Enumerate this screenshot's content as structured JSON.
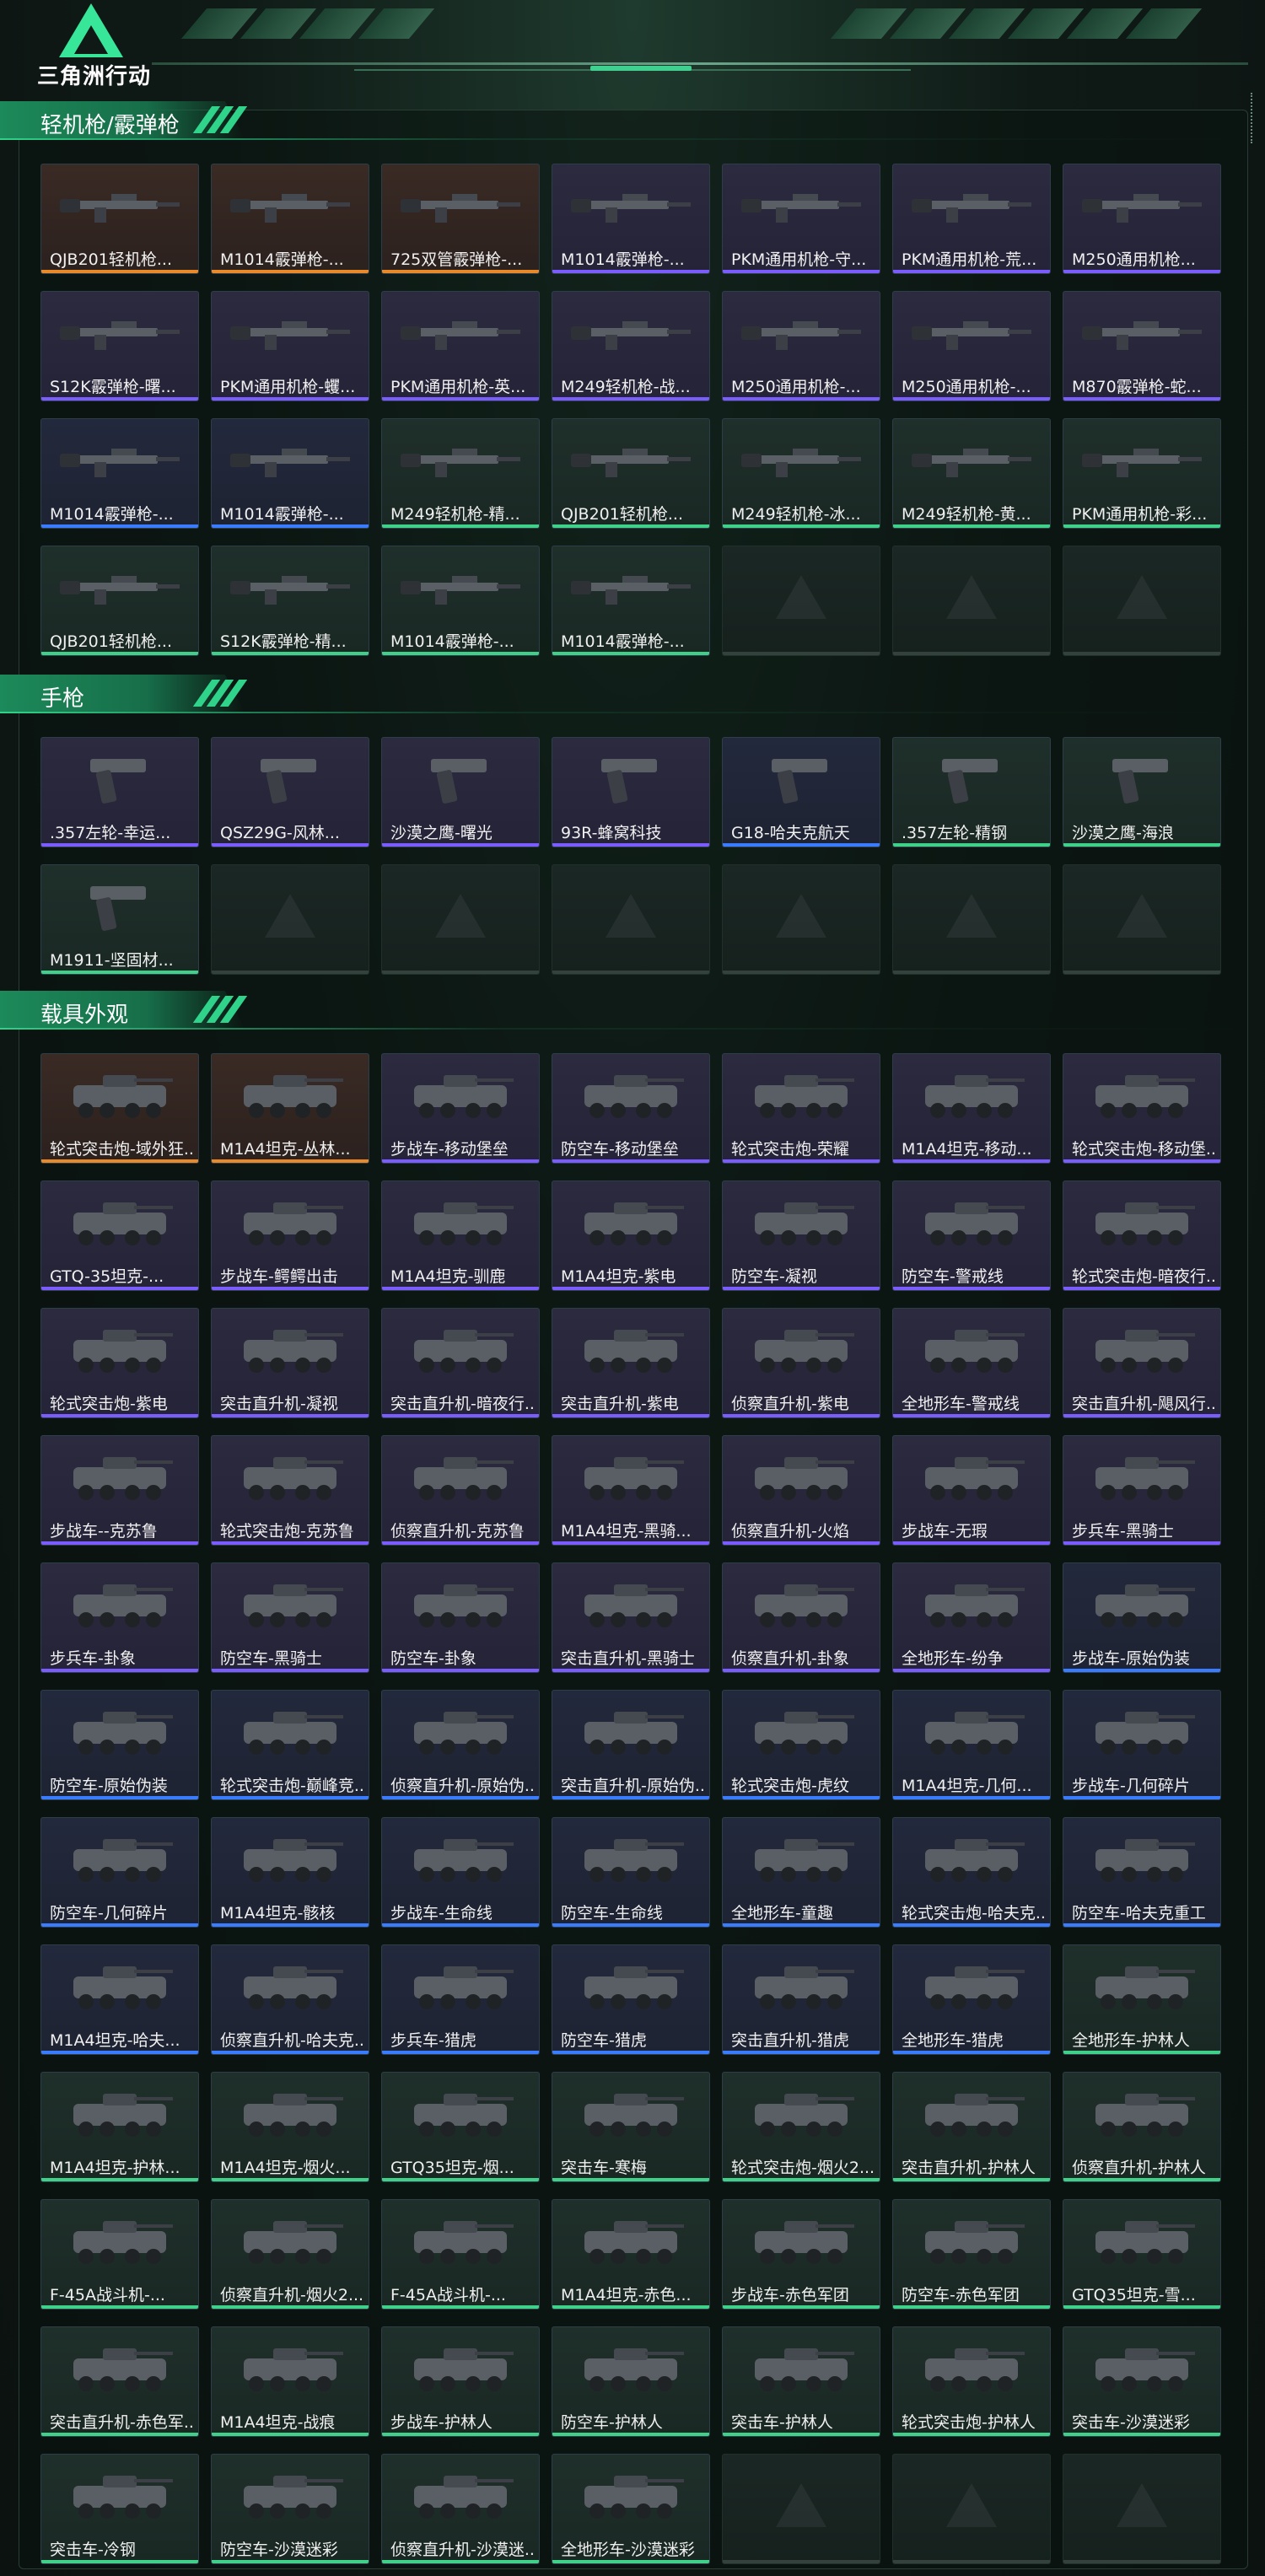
{
  "app": {
    "logo_text": "三角洲行动"
  },
  "sections": [
    {
      "title": "轻机枪/霰弹枪",
      "kind": "gun",
      "items": [
        {
          "label": "QJB201轻机枪...",
          "rarity": "orange"
        },
        {
          "label": "M1014霰弹枪-...",
          "rarity": "orange"
        },
        {
          "label": "725双管霰弹枪-...",
          "rarity": "orange"
        },
        {
          "label": "M1014霰弹枪-...",
          "rarity": "purple"
        },
        {
          "label": "PKM通用机枪-守...",
          "rarity": "purple"
        },
        {
          "label": "PKM通用机枪-荒...",
          "rarity": "purple"
        },
        {
          "label": "M250通用机枪...",
          "rarity": "purple"
        },
        {
          "label": "S12K霰弹枪-曙...",
          "rarity": "purple"
        },
        {
          "label": "PKM通用机枪-蠼...",
          "rarity": "purple"
        },
        {
          "label": "PKM通用机枪-英...",
          "rarity": "purple"
        },
        {
          "label": "M249轻机枪-战...",
          "rarity": "purple"
        },
        {
          "label": "M250通用机枪-...",
          "rarity": "purple"
        },
        {
          "label": "M250通用机枪-...",
          "rarity": "purple"
        },
        {
          "label": "M870霰弹枪-蛇...",
          "rarity": "purple"
        },
        {
          "label": "M1014霰弹枪-...",
          "rarity": "blue"
        },
        {
          "label": "M1014霰弹枪-...",
          "rarity": "blue"
        },
        {
          "label": "M249轻机枪-精...",
          "rarity": "green"
        },
        {
          "label": "QJB201轻机枪...",
          "rarity": "green"
        },
        {
          "label": "M249轻机枪-冰...",
          "rarity": "green"
        },
        {
          "label": "M249轻机枪-黄...",
          "rarity": "green"
        },
        {
          "label": "PKM通用机枪-彩...",
          "rarity": "green"
        },
        {
          "label": "QJB201轻机枪...",
          "rarity": "green"
        },
        {
          "label": "S12K霰弹枪-精...",
          "rarity": "green"
        },
        {
          "label": "M1014霰弹枪-...",
          "rarity": "green"
        },
        {
          "label": "M1014霰弹枪-...",
          "rarity": "green"
        }
      ],
      "empty_slots": 3
    },
    {
      "title": "手枪",
      "kind": "pistol",
      "items": [
        {
          "label": ".357左轮-幸运...",
          "rarity": "purple"
        },
        {
          "label": "QSZ29G-风林...",
          "rarity": "purple"
        },
        {
          "label": "沙漠之鹰-曙光",
          "rarity": "purple"
        },
        {
          "label": "93R-蜂窝科技",
          "rarity": "purple"
        },
        {
          "label": "G18-哈夫克航天",
          "rarity": "blue"
        },
        {
          "label": ".357左轮-精钢",
          "rarity": "green"
        },
        {
          "label": "沙漠之鹰-海浪",
          "rarity": "green"
        },
        {
          "label": "M1911-坚固材...",
          "rarity": "green"
        }
      ],
      "empty_slots": 6
    },
    {
      "title": "载具外观",
      "kind": "vehicle",
      "items": [
        {
          "label": "轮式突击炮-域外狂...",
          "rarity": "orange"
        },
        {
          "label": "M1A4坦克-丛林...",
          "rarity": "orange"
        },
        {
          "label": "步战车-移动堡垒",
          "rarity": "purple"
        },
        {
          "label": "防空车-移动堡垒",
          "rarity": "purple"
        },
        {
          "label": "轮式突击炮-荣耀",
          "rarity": "purple"
        },
        {
          "label": "M1A4坦克-移动...",
          "rarity": "purple"
        },
        {
          "label": "轮式突击炮-移动堡...",
          "rarity": "purple"
        },
        {
          "label": "GTQ-35坦克-...",
          "rarity": "purple"
        },
        {
          "label": "步战车-鳄鳄出击",
          "rarity": "purple"
        },
        {
          "label": "M1A4坦克-驯鹿",
          "rarity": "purple"
        },
        {
          "label": "M1A4坦克-紫电",
          "rarity": "purple"
        },
        {
          "label": "防空车-凝视",
          "rarity": "purple"
        },
        {
          "label": "防空车-警戒线",
          "rarity": "purple"
        },
        {
          "label": "轮式突击炮-暗夜行...",
          "rarity": "purple"
        },
        {
          "label": "轮式突击炮-紫电",
          "rarity": "purple"
        },
        {
          "label": "突击直升机-凝视",
          "rarity": "purple"
        },
        {
          "label": "突击直升机-暗夜行...",
          "rarity": "purple"
        },
        {
          "label": "突击直升机-紫电",
          "rarity": "purple"
        },
        {
          "label": "侦察直升机-紫电",
          "rarity": "purple"
        },
        {
          "label": "全地形车-警戒线",
          "rarity": "purple"
        },
        {
          "label": "突击直升机-飓风行...",
          "rarity": "purple"
        },
        {
          "label": "步战车--克苏鲁",
          "rarity": "purple"
        },
        {
          "label": "轮式突击炮-克苏鲁",
          "rarity": "purple"
        },
        {
          "label": "侦察直升机-克苏鲁",
          "rarity": "purple"
        },
        {
          "label": "M1A4坦克-黑骑...",
          "rarity": "purple"
        },
        {
          "label": "侦察直升机-火焰",
          "rarity": "purple"
        },
        {
          "label": "步战车-无瑕",
          "rarity": "purple"
        },
        {
          "label": "步兵车-黑骑士",
          "rarity": "purple"
        },
        {
          "label": "步兵车-卦象",
          "rarity": "purple"
        },
        {
          "label": "防空车-黑骑士",
          "rarity": "purple"
        },
        {
          "label": "防空车-卦象",
          "rarity": "purple"
        },
        {
          "label": "突击直升机-黑骑士",
          "rarity": "purple"
        },
        {
          "label": "侦察直升机-卦象",
          "rarity": "purple"
        },
        {
          "label": "全地形车-纷争",
          "rarity": "purple"
        },
        {
          "label": "步战车-原始伪装",
          "rarity": "blue"
        },
        {
          "label": "防空车-原始伪装",
          "rarity": "blue"
        },
        {
          "label": "轮式突击炮-巅峰竞...",
          "rarity": "blue"
        },
        {
          "label": "侦察直升机-原始伪...",
          "rarity": "blue"
        },
        {
          "label": "突击直升机-原始伪...",
          "rarity": "blue"
        },
        {
          "label": "轮式突击炮-虎纹",
          "rarity": "blue"
        },
        {
          "label": "M1A4坦克-几何...",
          "rarity": "blue"
        },
        {
          "label": "步战车-几何碎片",
          "rarity": "blue"
        },
        {
          "label": "防空车-几何碎片",
          "rarity": "blue"
        },
        {
          "label": "M1A4坦克-骸核",
          "rarity": "blue"
        },
        {
          "label": "步战车-生命线",
          "rarity": "blue"
        },
        {
          "label": "防空车-生命线",
          "rarity": "blue"
        },
        {
          "label": "全地形车-童趣",
          "rarity": "blue"
        },
        {
          "label": "轮式突击炮-哈夫克...",
          "rarity": "blue"
        },
        {
          "label": "防空车-哈夫克重工",
          "rarity": "blue"
        },
        {
          "label": "M1A4坦克-哈夫...",
          "rarity": "blue"
        },
        {
          "label": "侦察直升机-哈夫克...",
          "rarity": "blue"
        },
        {
          "label": "步兵车-猎虎",
          "rarity": "blue"
        },
        {
          "label": "防空车-猎虎",
          "rarity": "blue"
        },
        {
          "label": "突击直升机-猎虎",
          "rarity": "blue"
        },
        {
          "label": "全地形车-猎虎",
          "rarity": "blue"
        },
        {
          "label": "全地形车-护林人",
          "rarity": "green"
        },
        {
          "label": "M1A4坦克-护林...",
          "rarity": "green"
        },
        {
          "label": "M1A4坦克-烟火...",
          "rarity": "green"
        },
        {
          "label": "GTQ35坦克-烟...",
          "rarity": "green"
        },
        {
          "label": "突击车-寒梅",
          "rarity": "green"
        },
        {
          "label": "轮式突击炮-烟火2...",
          "rarity": "green"
        },
        {
          "label": "突击直升机-护林人",
          "rarity": "green"
        },
        {
          "label": "侦察直升机-护林人",
          "rarity": "green"
        },
        {
          "label": "F-45A战斗机-...",
          "rarity": "green"
        },
        {
          "label": "侦察直升机-烟火2...",
          "rarity": "green"
        },
        {
          "label": "F-45A战斗机-...",
          "rarity": "green"
        },
        {
          "label": "M1A4坦克-赤色...",
          "rarity": "green"
        },
        {
          "label": "步战车-赤色军团",
          "rarity": "green"
        },
        {
          "label": "防空车-赤色军团",
          "rarity": "green"
        },
        {
          "label": "GTQ35坦克-雪...",
          "rarity": "green"
        },
        {
          "label": "突击直升机-赤色军...",
          "rarity": "green"
        },
        {
          "label": "M1A4坦克-战痕",
          "rarity": "green"
        },
        {
          "label": "步战车-护林人",
          "rarity": "green"
        },
        {
          "label": "防空车-护林人",
          "rarity": "green"
        },
        {
          "label": "突击车-护林人",
          "rarity": "green"
        },
        {
          "label": "轮式突击炮-护林人",
          "rarity": "green"
        },
        {
          "label": "突击车-沙漠迷彩",
          "rarity": "green"
        },
        {
          "label": "突击车-冷钢",
          "rarity": "green"
        },
        {
          "label": "防空车-沙漠迷彩",
          "rarity": "green"
        },
        {
          "label": "侦察直升机-沙漠迷...",
          "rarity": "green"
        },
        {
          "label": "全地形车-沙漠迷彩",
          "rarity": "green"
        }
      ],
      "empty_slots": 3
    }
  ]
}
